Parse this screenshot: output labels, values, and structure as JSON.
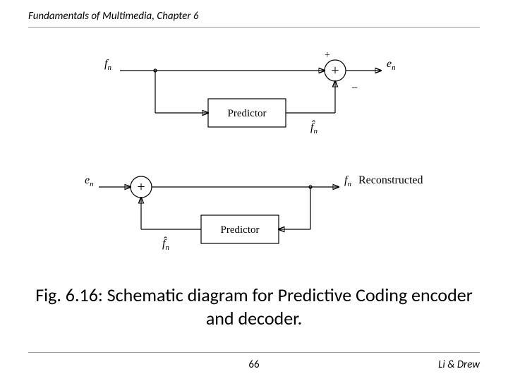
{
  "header": {
    "title": "Fundamentals of Multimedia, Chapter 6"
  },
  "caption": "Fig. 6.16: Schematic diagram for Predictive Coding encoder and decoder.",
  "page_number": "66",
  "authors": "Li & Drew",
  "encoder": {
    "input_symbol": "f",
    "input_sub": "n",
    "predictor_label": "Predictor",
    "predicted_symbol": "f̂",
    "predicted_sub": "n",
    "sum_plus": "+",
    "minus": "−",
    "top_plus": "+",
    "output_symbol": "e",
    "output_sub": "n"
  },
  "decoder": {
    "input_symbol": "e",
    "input_sub": "n",
    "sum_plus": "+",
    "predictor_label": "Predictor",
    "predicted_symbol": "f̂",
    "predicted_sub": "n",
    "output_symbol": "f",
    "output_sub": "n",
    "reconstructed": "Reconstructed"
  }
}
